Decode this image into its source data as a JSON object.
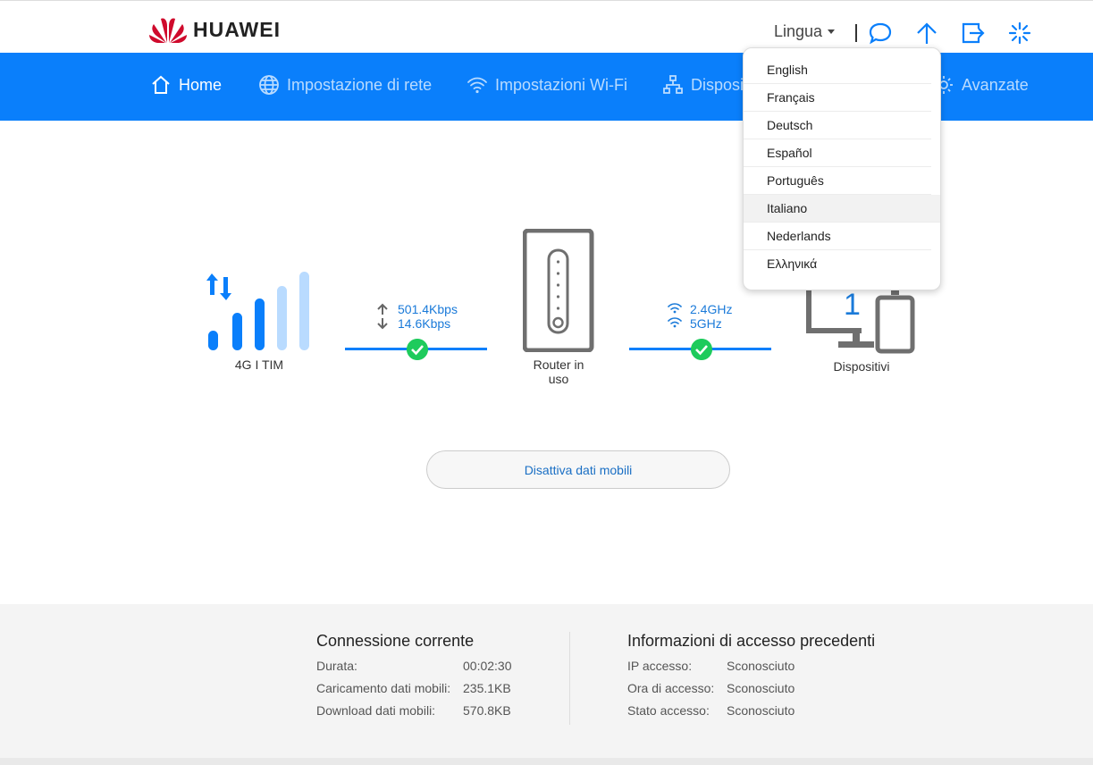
{
  "header": {
    "brand": "HUAWEI",
    "language_label": "Lingua"
  },
  "nav": {
    "items": [
      {
        "label": "Home",
        "icon": "home-icon"
      },
      {
        "label": "Impostazione di rete",
        "icon": "globe-icon"
      },
      {
        "label": "Impostazioni Wi-Fi",
        "icon": "wifi-icon"
      },
      {
        "label": "Dispositi",
        "icon": "devices-tree-icon"
      },
      {
        "label": "Avanzate",
        "icon": "gear-icon"
      }
    ]
  },
  "language_menu": {
    "options": [
      "English",
      "Français",
      "Deutsch",
      "Español",
      "Português",
      "Italiano",
      "Nederlands",
      "Ελληνικά"
    ],
    "highlighted": "Italiano"
  },
  "status": {
    "network_label": "4G  I TIM",
    "upload_rate": "501.4Kbps",
    "download_rate": "14.6Kbps",
    "router_label": "Router in uso",
    "wifi_24": "2.4GHz",
    "wifi_5": "5GHz",
    "devices_count": "1",
    "devices_label": "Dispositivi",
    "disable_button": "Disattiva dati mobili"
  },
  "current_connection": {
    "title": "Connessione corrente",
    "rows": [
      {
        "label": "Durata:",
        "value": "00:02:30"
      },
      {
        "label": "Caricamento dati mobili:",
        "value": "235.1KB"
      },
      {
        "label": "Download dati mobili:",
        "value": "570.8KB"
      }
    ]
  },
  "previous_access": {
    "title": "Informazioni di accesso precedenti",
    "rows": [
      {
        "label": "IP accesso:",
        "value": "Sconosciuto"
      },
      {
        "label": "Ora di accesso:",
        "value": "Sconosciuto"
      },
      {
        "label": "Stato accesso:",
        "value": "Sconosciuto"
      }
    ]
  },
  "colors": {
    "nav_bg": "#0a7ffb",
    "brand_red": "#cf0a2c",
    "ok_green": "#1ecb5c"
  }
}
